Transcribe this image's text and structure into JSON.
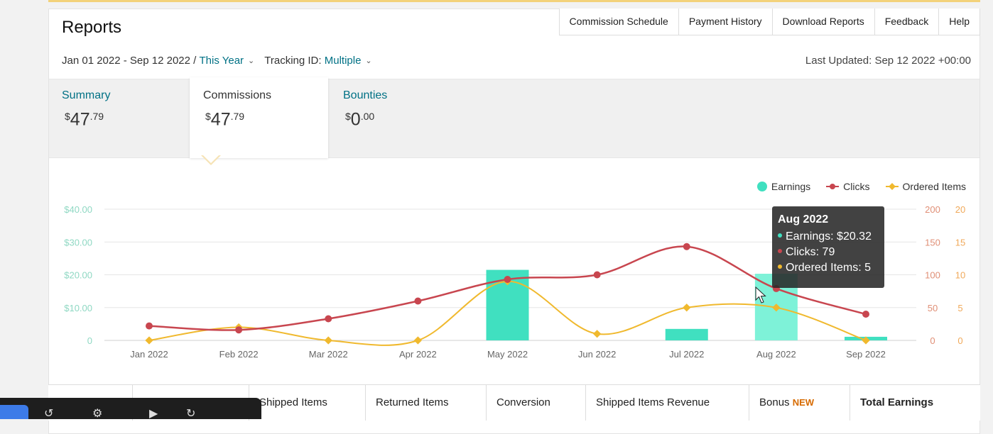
{
  "title": "Reports",
  "top_tabs": [
    "Commission Schedule",
    "Payment History",
    "Download Reports",
    "Feedback",
    "Help"
  ],
  "filters": {
    "date_range": "Jan 01 2022 - Sep 12 2022 /",
    "period": "This Year",
    "tracking_label": "Tracking ID:",
    "tracking_value": "Multiple"
  },
  "last_updated": "Last Updated: Sep 12 2022 +00:00",
  "stats": {
    "summary": {
      "label": "Summary",
      "currency": "$",
      "whole": "47",
      "cents": ".79"
    },
    "commissions": {
      "label": "Commissions",
      "currency": "$",
      "whole": "47",
      "cents": ".79"
    },
    "bounties": {
      "label": "Bounties",
      "currency": "$",
      "whole": "0",
      "cents": ".00"
    }
  },
  "legend": {
    "earnings": "Earnings",
    "clicks": "Clicks",
    "ordered": "Ordered Items"
  },
  "colors": {
    "earnings": "#40e0c0",
    "clicks": "#c8464f",
    "ordered": "#f0b92e",
    "link": "#007185"
  },
  "chart_data": {
    "type": "bar",
    "categories": [
      "Jan 2022",
      "Feb 2022",
      "Mar 2022",
      "Apr 2022",
      "May 2022",
      "Jun 2022",
      "Jul 2022",
      "Aug 2022",
      "Sep 2022"
    ],
    "series": [
      {
        "name": "Earnings",
        "type": "bar",
        "values": [
          0,
          0,
          0,
          0,
          21.5,
          0,
          3.5,
          20.32,
          1.1
        ]
      },
      {
        "name": "Clicks",
        "type": "line",
        "values": [
          22,
          16,
          33,
          60,
          93,
          100,
          143,
          79,
          40
        ]
      },
      {
        "name": "Ordered Items",
        "type": "line",
        "values": [
          0,
          2,
          0,
          0,
          9,
          1,
          5,
          5,
          0
        ]
      }
    ],
    "y_left_ticks": [
      "0",
      "$10.00",
      "$20.00",
      "$30.00",
      "$40.00"
    ],
    "y_left_range": [
      0,
      40
    ],
    "y_right1_ticks": [
      "0",
      "50",
      "100",
      "150",
      "200"
    ],
    "y_right1_range": [
      0,
      200
    ],
    "y_right2_ticks": [
      "0",
      "5",
      "10",
      "15",
      "20"
    ],
    "y_right2_range": [
      0,
      20
    ],
    "grid": true,
    "legend_position": "top-right"
  },
  "tooltip": {
    "title": "Aug 2022",
    "earnings": "Earnings: $20.32",
    "clicks": "Clicks: 79",
    "ordered": "Ordered Items: 5"
  },
  "bottom_columns": [
    "Shipped Items",
    "Returned Items",
    "Conversion",
    "Shipped Items Revenue",
    "Bonus",
    "Total Earnings"
  ],
  "bottom_new_tag": "NEW"
}
